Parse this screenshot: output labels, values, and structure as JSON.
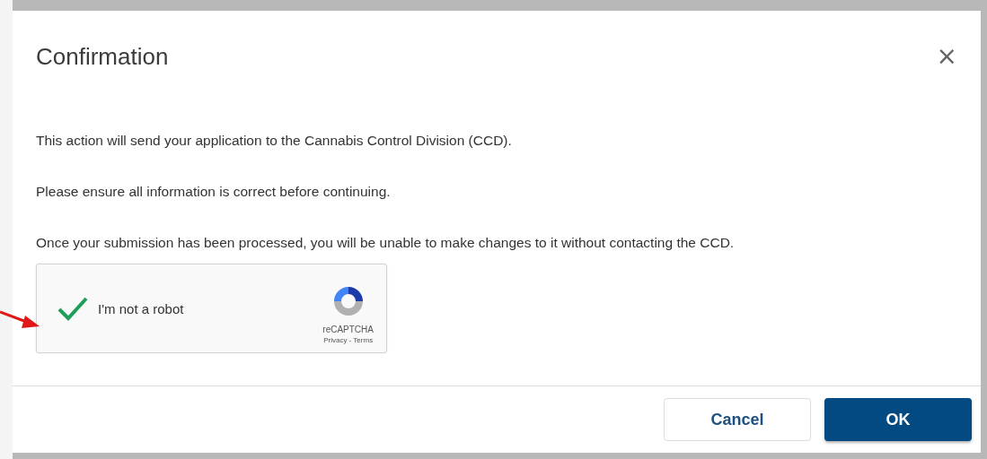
{
  "dialog": {
    "title": "Confirmation",
    "close": "×",
    "paragraphs": [
      "This action will send your application to the Cannabis Control Division (CCD).",
      "Please ensure all information is correct before continuing.",
      "Once your submission has been processed, you will be unable to make changes to it without contacting the CCD."
    ],
    "captcha": {
      "label": "I'm not a robot",
      "checked": true,
      "brand": "reCAPTCHA",
      "links": "Privacy - Terms"
    },
    "buttons": [
      {
        "label": "Cancel",
        "kind": "secondary"
      },
      {
        "label": "OK",
        "kind": "primary"
      }
    ]
  }
}
